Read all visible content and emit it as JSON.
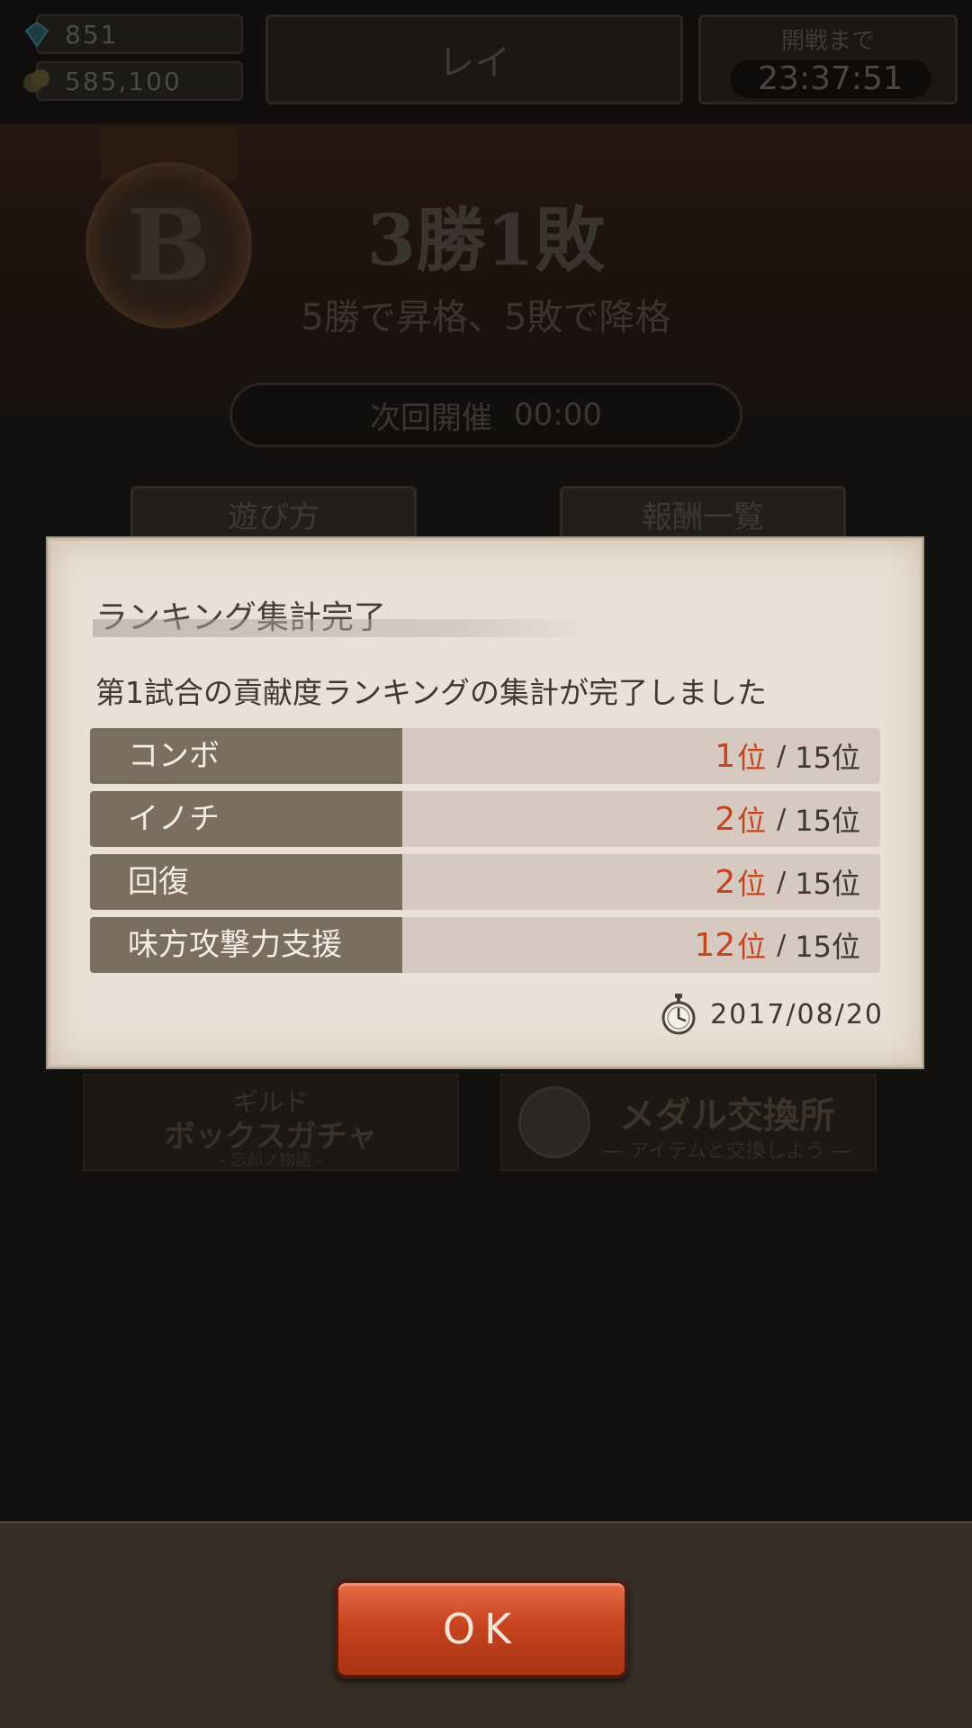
{
  "top_bar": {
    "gems": "851",
    "gold": "585,100",
    "player_name": "レイ",
    "countdown_label": "開戦まで",
    "countdown_value": "23:37:51"
  },
  "banner": {
    "rank_letter": "B",
    "record": "3勝1敗",
    "rule": "5勝で昇格、5敗で降格",
    "next_label": "次回開催",
    "next_time": "00:00"
  },
  "buttons": {
    "how_to_play": "遊び方",
    "rewards": "報酬一覧"
  },
  "promos": {
    "gacha_title": "ギルド",
    "gacha_main": "ボックスガチャ",
    "gacha_sub": "- 忘却ノ物語 -",
    "medal_main": "メダル交換所",
    "medal_sub": "― アイテムと交換しよう ―"
  },
  "dialog": {
    "title": "ランキング集計完了",
    "message": "第1試合の貢献度ランキングの集計が完了しました",
    "rows": [
      {
        "category": "コンボ",
        "rank": "1",
        "unit": "位",
        "total": "15位"
      },
      {
        "category": "イノチ",
        "rank": "2",
        "unit": "位",
        "total": "15位"
      },
      {
        "category": "回復",
        "rank": "2",
        "unit": "位",
        "total": "15位"
      },
      {
        "category": "味方攻撃力支援",
        "rank": "12",
        "unit": "位",
        "total": "15位"
      }
    ],
    "separator": "/",
    "date": "2017/08/20"
  },
  "footer": {
    "ok_label": "OK"
  },
  "colors": {
    "rank_accent": "#c4451d",
    "ok_button": "#c8431f",
    "dialog_bg": "#ebe0d5",
    "category_cell": "#7b6e5f"
  }
}
